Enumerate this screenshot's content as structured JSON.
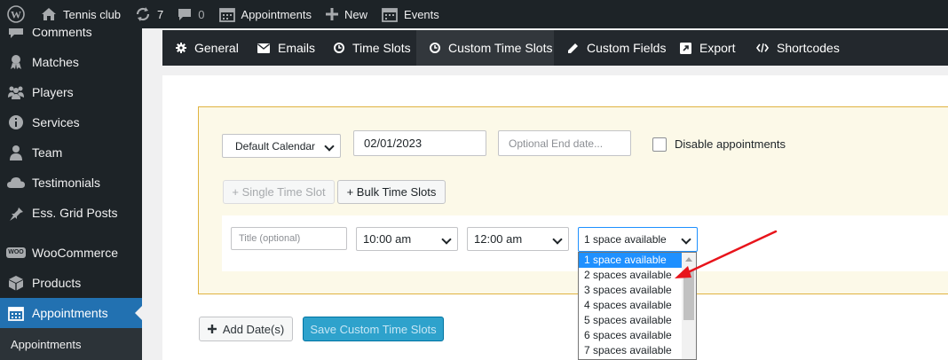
{
  "admin_bar": {
    "wp_icon": "wordpress-logo-icon",
    "site_name": "Tennis club",
    "updates_count": "7",
    "comments_count": "0",
    "appointments": "Appointments",
    "new": "New",
    "events": "Events"
  },
  "sidebar": {
    "items": [
      {
        "label": "Comments",
        "icon": "comments-icon"
      },
      {
        "label": "Matches",
        "icon": "award-icon"
      },
      {
        "label": "Players",
        "icon": "groups-icon"
      },
      {
        "label": "Services",
        "icon": "info-icon"
      },
      {
        "label": "Team",
        "icon": "person-icon"
      },
      {
        "label": "Testimonials",
        "icon": "cloud-icon"
      },
      {
        "label": "Ess. Grid Posts",
        "icon": "pin-icon"
      },
      {
        "label": "WooCommerce",
        "icon": "woocommerce-icon",
        "badge": "WOO"
      },
      {
        "label": "Products",
        "icon": "archive-icon"
      },
      {
        "label": "Appointments",
        "icon": "calendar-icon",
        "current": true
      }
    ],
    "submenu": "Appointments"
  },
  "tabs": [
    {
      "label": "General",
      "icon": "gear-icon"
    },
    {
      "label": "Emails",
      "icon": "envelope-icon"
    },
    {
      "label": "Time Slots",
      "icon": "clock-icon"
    },
    {
      "label": "Custom Time Slots",
      "icon": "clock-icon",
      "active": true
    },
    {
      "label": "Custom Fields",
      "icon": "pencil-icon"
    },
    {
      "label": "Export",
      "icon": "external-link-icon"
    },
    {
      "label": "Shortcodes",
      "icon": "code-icon"
    }
  ],
  "form": {
    "calendar_select": "Default Calendar",
    "start_date": "02/01/2023",
    "end_date_placeholder": "Optional End date...",
    "disable_label": "Disable appointments",
    "single_slot_button": "+ Single Time Slot",
    "bulk_slots_button": "+ Bulk Time Slots",
    "title_placeholder": "Title (optional)",
    "start_time": "10:00 am",
    "end_time": "12:00 am",
    "spaces_select": "1 space available",
    "spaces_options": [
      "1 space available",
      "2 spaces available",
      "3 spaces available",
      "4 spaces available",
      "5 spaces available",
      "6 spaces available",
      "7 spaces available"
    ],
    "add_dates_button": "Add Date(s)",
    "save_button": "Save Custom Time Slots"
  },
  "colors": {
    "admin_dark": "#1d2327",
    "current_menu": "#2271b1",
    "tab_bar": "#23282d",
    "tab_active": "#32373c",
    "box_border": "#e0b340",
    "box_bg": "#fcf9e8",
    "selected_option": "#1e90ff",
    "save_button": "#2ea2cc",
    "annotation_arrow": "#e8141b"
  }
}
